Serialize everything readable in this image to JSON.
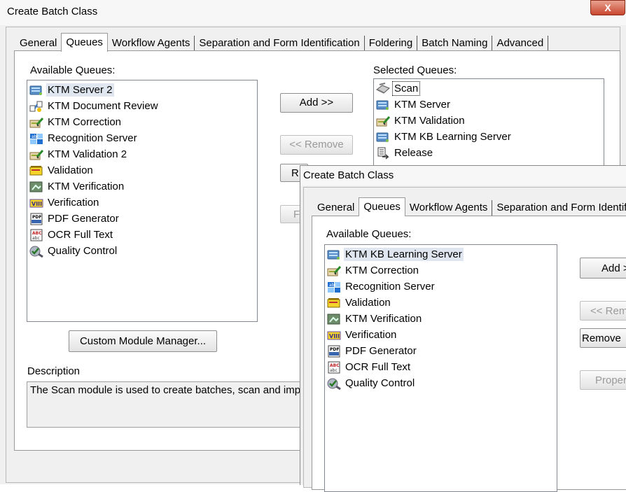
{
  "back": {
    "title": "Create Batch Class",
    "close_label": "X",
    "tabs": [
      "General",
      "Queues",
      "Workflow Agents",
      "Separation and Form Identification",
      "Foldering",
      "Batch Naming",
      "Advanced"
    ],
    "available_label": "Available Queues:",
    "selected_label": "Selected Queues:",
    "available": [
      {
        "label": "KTM Server 2",
        "icon": "server-icon"
      },
      {
        "label": "KTM Document Review",
        "icon": "document-review-icon"
      },
      {
        "label": "KTM Correction",
        "icon": "correction-icon"
      },
      {
        "label": "Recognition Server",
        "icon": "recognition-icon"
      },
      {
        "label": "KTM Validation 2",
        "icon": "correction-icon"
      },
      {
        "label": "Validation",
        "icon": "validation-icon"
      },
      {
        "label": "KTM Verification",
        "icon": "verification-image-icon"
      },
      {
        "label": "Verification",
        "icon": "verification-icon"
      },
      {
        "label": "PDF Generator",
        "icon": "pdf-icon"
      },
      {
        "label": "OCR Full Text",
        "icon": "ocr-icon"
      },
      {
        "label": "Quality Control",
        "icon": "quality-control-icon"
      }
    ],
    "selected": [
      {
        "label": "Scan",
        "icon": "scanner-icon"
      },
      {
        "label": "KTM Server",
        "icon": "server-icon"
      },
      {
        "label": "KTM Validation",
        "icon": "correction-icon"
      },
      {
        "label": "KTM KB Learning Server",
        "icon": "server-icon"
      },
      {
        "label": "Release",
        "icon": "release-icon"
      }
    ],
    "add_label": "Add >>",
    "remove_label": "<< Remove",
    "r_partial": "R",
    "f_partial": "F",
    "custom_module_label": "Custom Module Manager...",
    "description_label": "Description",
    "description_text": "The Scan module is used to create batches, scan and impor"
  },
  "front": {
    "title": "Create Batch Class",
    "tabs": [
      "General",
      "Queues",
      "Workflow Agents",
      "Separation and Form Identifi"
    ],
    "available_label": "Available Queues:",
    "available": [
      {
        "label": "KTM KB Learning Server",
        "icon": "server-icon"
      },
      {
        "label": "KTM Correction",
        "icon": "correction-icon"
      },
      {
        "label": "Recognition Server",
        "icon": "recognition-icon"
      },
      {
        "label": "Validation",
        "icon": "validation-icon"
      },
      {
        "label": "KTM Verification",
        "icon": "verification-image-icon"
      },
      {
        "label": "Verification",
        "icon": "verification-icon"
      },
      {
        "label": "PDF Generator",
        "icon": "pdf-icon"
      },
      {
        "label": "OCR Full Text",
        "icon": "ocr-icon"
      },
      {
        "label": "Quality Control",
        "icon": "quality-control-icon"
      }
    ],
    "add_label": "Add >",
    "remove_label": "<< Rem",
    "remove2_label": "Remove",
    "properties_label": "Propert"
  }
}
